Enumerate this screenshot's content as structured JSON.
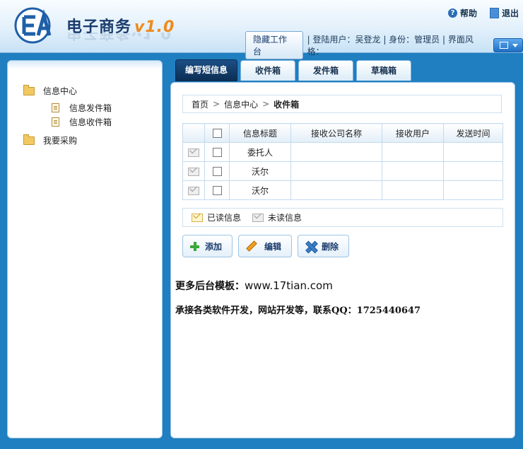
{
  "header": {
    "logo_text": "EA",
    "title": "电子商务",
    "version": "v1.0",
    "help_label": "帮助",
    "exit_label": "退出",
    "hide_workbench_label": "隐藏工作台",
    "user_info": "| 登陆用户：吴登龙 | 身份：管理员 | 界面风格：",
    "icons": {
      "help": "help-icon",
      "exit": "exit-icon",
      "theme": "theme-icon"
    }
  },
  "sidebar": {
    "items": [
      {
        "label": "信息中心",
        "icon": "folder-icon",
        "level": 1
      },
      {
        "label": "信息发件箱",
        "icon": "document-icon",
        "level": 2
      },
      {
        "label": "信息收件箱",
        "icon": "document-icon",
        "level": 2
      },
      {
        "label": "我要采购",
        "icon": "folder-icon",
        "level": 1
      }
    ]
  },
  "tabs": [
    {
      "label": "编写短信息",
      "active": true
    },
    {
      "label": "收件箱",
      "active": false
    },
    {
      "label": "发件箱",
      "active": false
    },
    {
      "label": "草稿箱",
      "active": false
    }
  ],
  "breadcrumb": {
    "home": "首页",
    "sep": ">",
    "level1": "信息中心",
    "current": "收件箱"
  },
  "table": {
    "columns": [
      "",
      "",
      "信息标题",
      "接收公司名称",
      "接收用户",
      "发送时间"
    ],
    "rows": [
      {
        "title": "委托人",
        "company": "",
        "user": "",
        "time": ""
      },
      {
        "title": "沃尔",
        "company": "",
        "user": "",
        "time": ""
      },
      {
        "title": "沃尔",
        "company": "",
        "user": "",
        "time": ""
      }
    ]
  },
  "legend": {
    "read_label": "已读信息",
    "unread_label": "未读信息"
  },
  "actions": {
    "add_label": "添加",
    "edit_label": "编辑",
    "delete_label": "删除"
  },
  "promo": {
    "line1_prefix": "更多后台模板：",
    "line1_url": "www.17tian.com",
    "line2": "承接各类软件开发，网站开发等，联系QQ：1725440647"
  },
  "colors": {
    "background": "#1f7fc0",
    "active_tab": "#0b2d52",
    "version_accent": "#f08a1c",
    "title": "#1b3d6e"
  }
}
